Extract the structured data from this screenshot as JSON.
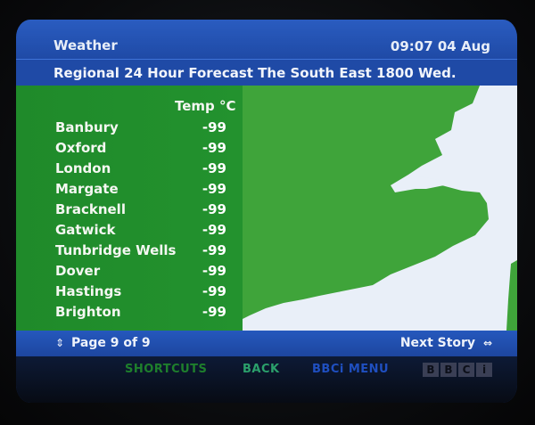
{
  "header": {
    "service_title": "Weather",
    "clock": "09:07  04 Aug",
    "subtitle": "Regional 24 Hour Forecast The South East 1800 Wed."
  },
  "forecast": {
    "column_header": "Temp °C",
    "rows": [
      {
        "city": "Banbury",
        "temp": "-99"
      },
      {
        "city": "Oxford",
        "temp": "-99"
      },
      {
        "city": "London",
        "temp": "-99"
      },
      {
        "city": "Margate",
        "temp": "-99"
      },
      {
        "city": "Bracknell",
        "temp": "-99"
      },
      {
        "city": "Gatwick",
        "temp": "-99"
      },
      {
        "city": "Tunbridge Wells",
        "temp": "-99"
      },
      {
        "city": "Dover",
        "temp": "-99"
      },
      {
        "city": "Hastings",
        "temp": "-99"
      },
      {
        "city": "Brighton",
        "temp": "-99"
      }
    ]
  },
  "footer": {
    "page_indicator": "Page 9 of 9",
    "next_story": "Next Story"
  },
  "menu": {
    "left": "",
    "shortcuts": "SHORTCUTS",
    "back": "BACK",
    "bbci_menu": "BBCi MENU",
    "logo_letters": [
      "B",
      "B",
      "C",
      "i"
    ]
  },
  "colors": {
    "header_blue": "#1f4aa6",
    "panel_green": "#23922e",
    "land_green": "#3fa43a",
    "sea": "#e9eff8"
  },
  "icons": {
    "page_nav": "up-down-arrows-icon",
    "next_story": "right-left-arrows-icon"
  }
}
